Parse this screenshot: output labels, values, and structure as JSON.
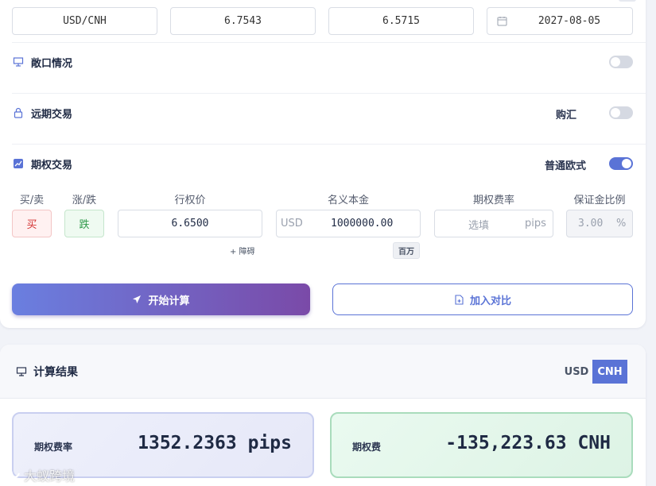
{
  "quote": {
    "pair": "USD/CNH",
    "rate_a": "6.7543",
    "rate_b": "6.5715",
    "date": "2027-08-05"
  },
  "sections": {
    "exposure": {
      "title": "敞口情况",
      "enabled": false
    },
    "forward": {
      "title": "远期交易",
      "side_label": "购汇",
      "enabled": false
    },
    "option": {
      "title": "期权交易",
      "style_label": "普通欧式",
      "enabled": true
    }
  },
  "option_form": {
    "labels": {
      "buy_sell": "买/卖",
      "up_down": "涨/跌",
      "strike": "行权价",
      "notional": "名义本金",
      "premium_rate": "期权费率",
      "margin_ratio": "保证金比例"
    },
    "buy_sell_value": "买",
    "up_down_value": "跌",
    "strike_value": "6.6500",
    "barrier_link": "+ 障碍",
    "notional_currency": "USD",
    "notional_value": "1000000.00",
    "notional_unit_tag": "百万",
    "premium_placeholder": "选填",
    "premium_unit": "pips",
    "margin_value": "3.00",
    "margin_unit": "%"
  },
  "actions": {
    "calculate": "开始计算",
    "compare": "加入对比"
  },
  "result": {
    "title": "计算结果",
    "currency_options": [
      "USD",
      "CNH"
    ],
    "selected_currency": "CNH",
    "premium_rate_label": "期权费率",
    "premium_rate_value": "1352.2363 pips",
    "premium_label": "期权费",
    "premium_value": "-135,223.63 CNH"
  },
  "watermark": "大蚁跨境",
  "colors": {
    "accent": "#5a73d6",
    "buy_red": "#d33232",
    "down_green": "#2f9a4a",
    "gradient_start": "#6a7fe0",
    "gradient_end": "#7a4aa8"
  }
}
